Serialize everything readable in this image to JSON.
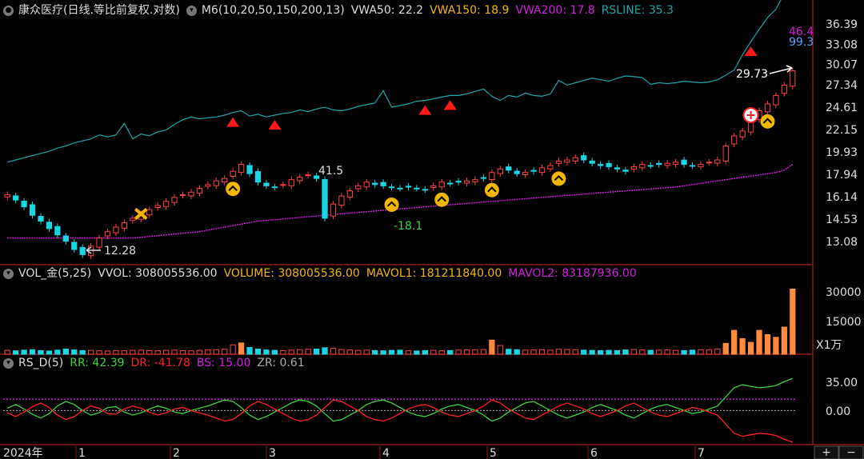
{
  "colors": {
    "up": "#ff4040",
    "down": "#19d5e6",
    "vwa50": "#18a7a7",
    "vwa200": "#d41ce0",
    "rr": "#3cd23c",
    "dr": "#ff2020",
    "bs": "#d41ce0",
    "gold": "#f2b500"
  },
  "header_main": {
    "title": "康众医疗(日线.等比前复权.对数)",
    "indicator": "M6(10,20,50,150,200,13)",
    "vwa50": "VWA50: 22.2",
    "vwa150": "VWA150: 18.9",
    "vwa200": "VWA200: 17.8",
    "rsline": "RSLINE: 35.3"
  },
  "header_vol": {
    "name": "VOL_金(5,25)",
    "vvol": "VVOL: 308005536.00",
    "volume": "VOLUME: 308005536.00",
    "mavol1": "MAVOL1: 181211840.00",
    "mavol2": "MAVOL2: 83187936.00"
  },
  "header_rs": {
    "name": "RS_D(5)",
    "rr": "RR: 42.39",
    "dr": "DR: -41.78",
    "bs": "BS: 15.00",
    "zr": "ZR: 0.61"
  },
  "price_axis": [
    "36.39",
    "33.08",
    "30.07",
    "27.34",
    "24.61",
    "22.15",
    "19.93",
    "17.94",
    "16.14",
    "14.53",
    "13.08"
  ],
  "rsline_labels": [
    "46.4",
    "99.3"
  ],
  "vol_axis": [
    "30000",
    "15000"
  ],
  "vol_unit": "X1万",
  "rs_axis": [
    "35.00",
    "0.00"
  ],
  "date_labels": [
    "2024年",
    "1",
    "2",
    "3",
    "4",
    "5",
    "6",
    "7"
  ],
  "annotations": {
    "high_mark": "41.5",
    "low_mark": "-18.1",
    "min_price": "12.28",
    "last_price": "29.73"
  },
  "footer_buttons": [
    "+",
    "−"
  ],
  "chart_data": {
    "type": "candlestick",
    "title": "康众医疗(日线.等比前复权.对数)",
    "x": [
      "2024年",
      "1",
      "2",
      "3",
      "4",
      "5",
      "6",
      "7"
    ],
    "y_scale": "log",
    "ylim": [
      12.0,
      37.5
    ],
    "notes": "approximate daily path read from chart",
    "price_path": [
      16.3,
      15.9,
      15.4,
      14.8,
      14.4,
      13.9,
      13.5,
      13.1,
      12.6,
      12.3,
      12.8,
      13.3,
      13.7,
      14.0,
      14.3,
      14.6,
      14.9,
      15.2,
      15.5,
      15.8,
      16.1,
      16.3,
      16.5,
      16.8,
      17.1,
      17.4,
      17.6,
      18.2,
      18.8,
      18.0,
      17.3,
      17.0,
      16.9,
      17.1,
      17.5,
      17.7,
      17.9,
      17.6,
      14.6,
      15.6,
      16.2,
      16.6,
      17.0,
      17.3,
      17.1,
      17.0,
      16.9,
      16.8,
      16.9,
      16.8,
      16.7,
      17.0,
      17.3,
      17.2,
      17.3,
      17.4,
      17.5,
      17.6,
      18.1,
      18.4,
      18.3,
      18.0,
      18.1,
      18.2,
      18.5,
      18.7,
      19.1,
      19.2,
      19.4,
      19.2,
      18.9,
      18.7,
      18.6,
      18.4,
      18.2,
      18.6,
      18.8,
      18.7,
      18.8,
      18.9,
      19.0,
      18.8,
      18.7,
      18.8,
      19.0,
      19.2,
      20.5,
      21.5,
      22.0,
      23.0,
      24.2,
      25.0,
      26.0,
      27.3,
      29.2
    ],
    "volume": [
      1800,
      1600,
      1900,
      2100,
      1700,
      1500,
      1900,
      2400,
      2000,
      1700,
      1800,
      1600,
      1500,
      1700,
      1600,
      1800,
      1900,
      1700,
      1600,
      1800,
      1900,
      1700,
      1600,
      1800,
      2000,
      2100,
      2300,
      4300,
      5200,
      3100,
      2400,
      2000,
      1800,
      1700,
      1900,
      2100,
      2300,
      2400,
      3000,
      2700,
      2200,
      2000,
      1800,
      1900,
      1700,
      1600,
      1800,
      1900,
      1600,
      1500,
      1700,
      1800,
      1600,
      1700,
      1900,
      2000,
      2100,
      2200,
      6500,
      4000,
      2300,
      2100,
      1900,
      2000,
      2100,
      1900,
      2300,
      2200,
      2100,
      1900,
      1800,
      1700,
      1800,
      1700,
      2000,
      2200,
      2000,
      1800,
      1900,
      2000,
      1800,
      1700,
      1900,
      2100,
      2000,
      2400,
      5000,
      11000,
      7200,
      5500,
      11000,
      9000,
      7800,
      12500,
      30000
    ],
    "series": [
      {
        "name": "VWA50",
        "values": [
          19.0,
          19.2,
          19.4,
          19.6,
          19.8,
          20.0,
          20.3,
          20.5,
          20.8,
          21.0,
          21.2,
          21.6,
          21.4,
          21.6,
          22.8,
          21.2,
          21.7,
          21.5,
          21.9,
          22.1,
          22.7,
          23.2,
          23.5,
          23.3,
          23.4,
          23.5,
          23.7,
          24.0,
          24.2,
          23.6,
          23.8,
          23.5,
          23.7,
          23.9,
          24.0,
          24.3,
          24.1,
          24.4,
          24.6,
          24.3,
          24.2,
          24.4,
          24.7,
          24.9,
          25.1,
          26.6,
          24.6,
          24.8,
          25.0,
          25.3,
          25.4,
          25.6,
          25.8,
          26.0,
          26.0,
          26.2,
          26.5,
          26.8,
          25.9,
          25.4,
          26.0,
          25.8,
          26.3,
          26.0,
          25.9,
          26.2,
          27.9,
          27.3,
          27.6,
          27.9,
          28.2,
          28.0,
          27.8,
          28.2,
          28.5,
          28.4,
          28.3,
          27.4,
          27.6,
          27.5,
          27.6,
          27.8,
          27.7,
          27.6,
          27.7,
          28.0,
          28.6,
          29.3,
          31.5,
          33.5,
          35.5,
          37.5,
          39.0,
          42.0,
          46.4
        ]
      },
      {
        "name": "VWA200",
        "values": [
          13.3,
          13.3,
          13.3,
          13.3,
          13.3,
          13.3,
          13.3,
          13.3,
          13.3,
          13.3,
          13.3,
          13.3,
          13.3,
          13.3,
          13.3,
          13.3,
          13.35,
          13.4,
          13.45,
          13.5,
          13.55,
          13.6,
          13.65,
          13.7,
          13.8,
          13.9,
          14.0,
          14.1,
          14.2,
          14.3,
          14.4,
          14.45,
          14.5,
          14.55,
          14.6,
          14.65,
          14.7,
          14.75,
          14.8,
          14.85,
          14.9,
          14.95,
          15.0,
          15.05,
          15.1,
          15.15,
          15.2,
          15.25,
          15.3,
          15.35,
          15.4,
          15.45,
          15.5,
          15.55,
          15.6,
          15.65,
          15.7,
          15.75,
          15.8,
          15.85,
          15.9,
          15.95,
          16.0,
          16.05,
          16.1,
          16.15,
          16.2,
          16.25,
          16.3,
          16.35,
          16.4,
          16.45,
          16.5,
          16.55,
          16.6,
          16.65,
          16.7,
          16.75,
          16.8,
          16.85,
          16.9,
          17.0,
          17.1,
          17.2,
          17.3,
          17.4,
          17.5,
          17.6,
          17.7,
          17.8,
          17.9,
          18.0,
          18.1,
          18.3,
          18.8
        ]
      }
    ],
    "rs_data": {
      "rr": [
        3,
        8,
        2,
        -5,
        -10,
        -4,
        6,
        12,
        8,
        0,
        -6,
        -3,
        4,
        5,
        -2,
        -6,
        -3,
        2,
        6,
        3,
        -2,
        -4,
        0,
        3,
        6,
        10,
        14,
        12,
        4,
        -6,
        -12,
        -8,
        -2,
        4,
        10,
        14,
        12,
        6,
        -4,
        -14,
        -12,
        -6,
        0,
        8,
        12,
        14,
        10,
        4,
        -2,
        -6,
        -8,
        -4,
        2,
        6,
        8,
        4,
        0,
        -6,
        -14,
        -10,
        -2,
        4,
        10,
        12,
        6,
        0,
        -6,
        -10,
        -6,
        -2,
        4,
        8,
        4,
        0,
        -6,
        -10,
        -4,
        2,
        6,
        8,
        4,
        0,
        -4,
        -2,
        2,
        6,
        18,
        30,
        34,
        32,
        30,
        31,
        33,
        38,
        42.39
      ],
      "dr": [
        -3,
        -8,
        -2,
        5,
        10,
        4,
        -6,
        -12,
        -8,
        0,
        6,
        3,
        -4,
        -5,
        2,
        6,
        3,
        -2,
        -6,
        -3,
        2,
        4,
        0,
        -3,
        -6,
        -10,
        -14,
        -12,
        -4,
        6,
        12,
        8,
        2,
        -4,
        -10,
        -14,
        -12,
        -6,
        4,
        14,
        12,
        6,
        0,
        -8,
        -12,
        -14,
        -10,
        -4,
        2,
        6,
        8,
        4,
        -2,
        -6,
        -8,
        -4,
        0,
        6,
        14,
        10,
        2,
        -4,
        -10,
        -12,
        -6,
        0,
        6,
        10,
        6,
        2,
        -4,
        -8,
        -4,
        0,
        6,
        10,
        4,
        -2,
        -6,
        -8,
        -4,
        0,
        4,
        2,
        -2,
        -6,
        -18,
        -30,
        -34,
        -32,
        -30,
        -31,
        -33,
        -38,
        -41.78
      ],
      "bs": 15.0,
      "ylim": [
        -45,
        50
      ]
    },
    "signals": {
      "buy_up_icons": [
        27,
        46,
        52,
        58,
        66,
        91
      ],
      "sell_triangles": [
        27,
        32,
        50,
        53,
        89
      ],
      "x_star": 16,
      "plus_circle": 89
    }
  }
}
